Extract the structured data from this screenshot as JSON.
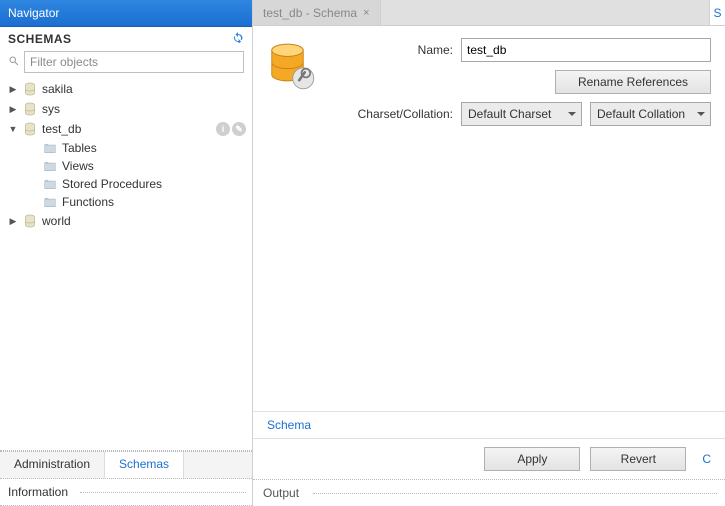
{
  "navigator": {
    "title": "Navigator",
    "section": "SCHEMAS",
    "filter_placeholder": "Filter objects",
    "items": {
      "sakila": "sakila",
      "sys": "sys",
      "test_db": "test_db",
      "world": "world"
    },
    "test_db_children": {
      "tables": "Tables",
      "views": "Views",
      "sp": "Stored Procedures",
      "functions": "Functions"
    },
    "tabs": {
      "admin": "Administration",
      "schemas": "Schemas"
    },
    "info": "Information"
  },
  "editor": {
    "tab_label": "test_db - Schema",
    "form": {
      "name_label": "Name:",
      "name_value": "test_db",
      "rename_btn": "Rename References",
      "charset_label": "Charset/Collation:",
      "charset_value": "Default Charset",
      "collation_value": "Default Collation"
    },
    "bottom_tab": "Schema",
    "apply": "Apply",
    "revert": "Revert",
    "output": "Output"
  }
}
